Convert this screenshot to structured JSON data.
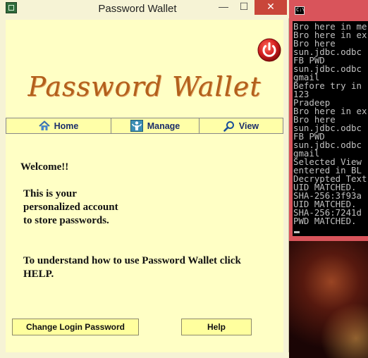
{
  "window": {
    "title": "Password Wallet",
    "minimize_glyph": "—",
    "maximize_glyph": "☐",
    "close_glyph": "✕"
  },
  "logo": {
    "text": "Password Wallet"
  },
  "nav": {
    "tabs": [
      {
        "label": "Home",
        "icon": "home-icon"
      },
      {
        "label": "Manage",
        "icon": "manage-icon"
      },
      {
        "label": "View",
        "icon": "magnifier-icon"
      }
    ]
  },
  "main": {
    "welcome": "Welcome!!",
    "intro_lines": [
      "This is your",
      "personalized account",
      "to store passwords."
    ],
    "help_line1": "To understand how to use Password Wallet click",
    "help_line2": "HELP."
  },
  "buttons": {
    "change_password": "Change Login Password",
    "help": "Help"
  },
  "console": {
    "icon_label": "C:\\",
    "lines": [
      "Bro here in me",
      "Bro here in ex",
      "Bro here",
      "sun.jdbc.odbc",
      "FB PWD",
      "sun.jdbc.odbc",
      "gmail",
      "Before try in",
      "123",
      "Pradeep",
      "Bro here in ex",
      "Bro here",
      "sun.jdbc.odbc",
      "FB PWD",
      "sun.jdbc.odbc",
      "gmail",
      "Selected View",
      "entered in BL",
      "Decrypted Text",
      "UID MATCHED.",
      "SHA-256:3f93a",
      "UID MATCHED.",
      "SHA-256:7241d",
      "PWD MATCHED."
    ]
  },
  "colors": {
    "content_bg": "#ffffc5",
    "logo": "#b2601c",
    "nav_text": "#1b2e6a",
    "console_frame": "#d9545b",
    "power_button": "#d42020"
  }
}
